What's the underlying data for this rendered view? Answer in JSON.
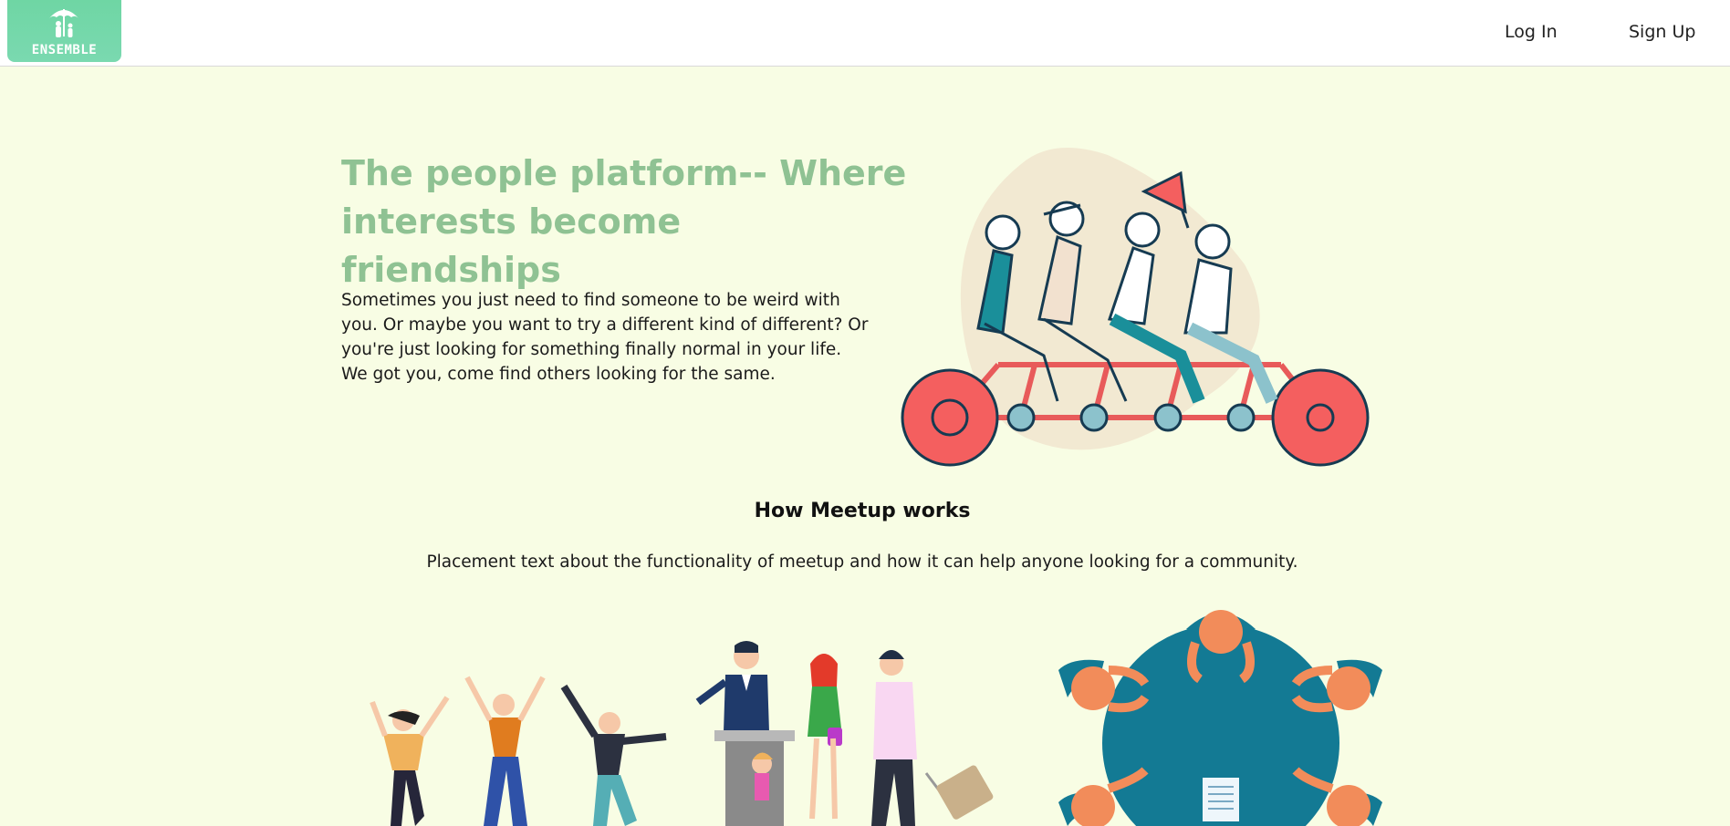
{
  "header": {
    "logo_text": "ENSEMBLE",
    "login_label": "Log In",
    "signup_label": "Sign Up"
  },
  "hero": {
    "title": "The people platform-- Where interests become friendships",
    "body": "Sometimes you just need to find someone to be weird with you. Or maybe you want to try a different kind of different? Or you're just looking for something finally normal in your life. We got you, come find others looking for the same."
  },
  "how_it_works": {
    "title": "How Meetup works",
    "body": "Placement text about the functionality of meetup and how it can help anyone looking for a community."
  },
  "colors": {
    "background": "#f8fde4",
    "accent_green": "#8fc293",
    "logo_green": "#6fd6a4"
  },
  "icons": [
    "umbrella-family-logo-icon",
    "tandem-bike-illustration",
    "dancing-people-illustration",
    "speaker-crowd-illustration",
    "round-table-meeting-illustration"
  ]
}
